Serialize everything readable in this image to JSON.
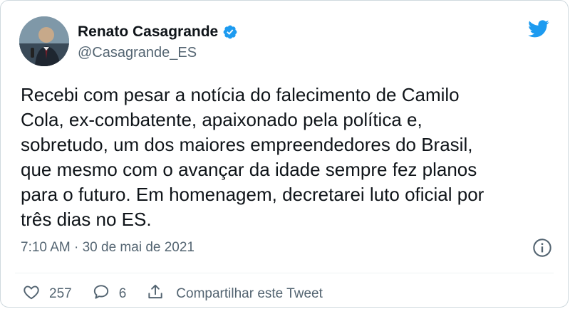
{
  "author": {
    "name": "Renato Casagrande",
    "handle": "@Casagrande_ES",
    "verified": true
  },
  "tweet": {
    "text": "Recebi com pesar a notícia do falecimento de Camilo\nCola, ex-combatente, apaixonado pela política e,\nsobretudo, um dos maiores empreendedores do Brasil,\nque mesmo com o avançar da idade sempre fez planos\npara o futuro. Em homenagem, decretarei luto oficial por\ntrês dias no ES.",
    "timestamp": "7:10 AM · 30 de mai de 2021"
  },
  "actions": {
    "likes": "257",
    "replies": "6",
    "share_label": "Compartilhar este Tweet"
  },
  "icons": {
    "brand": "twitter-bird-icon",
    "info": "info-icon",
    "like": "heart-icon",
    "reply": "comment-icon",
    "share": "share-icon"
  },
  "colors": {
    "brand_blue": "#1d9bf0",
    "text": "#0f1419",
    "secondary_text": "#536471"
  }
}
